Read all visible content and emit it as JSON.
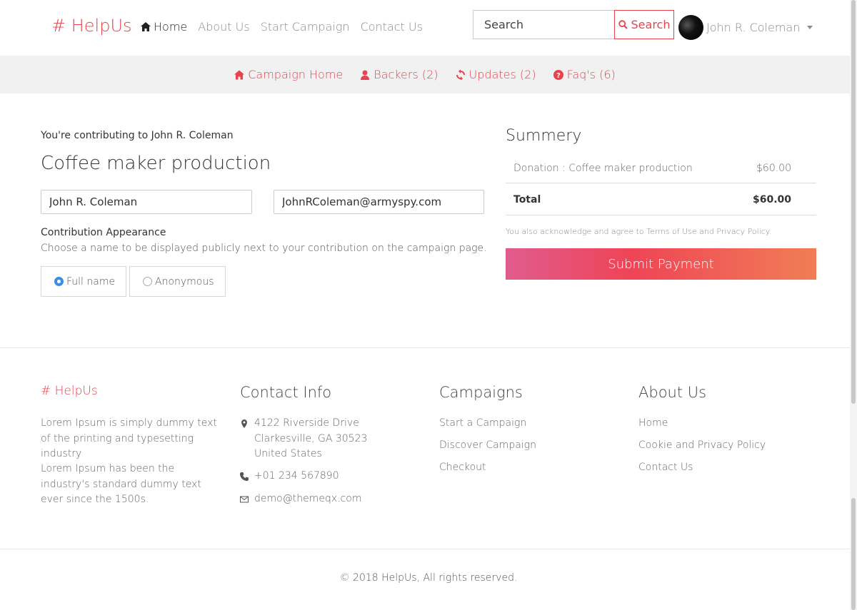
{
  "header": {
    "brand": "# HelpUs",
    "nav": [
      {
        "label": "Home",
        "active": true
      },
      {
        "label": "About Us"
      },
      {
        "label": "Start Campaign"
      },
      {
        "label": "Contact Us"
      }
    ],
    "search_placeholder": "Search",
    "search_button": "Search",
    "user_name": "John R. Coleman"
  },
  "subnav": {
    "campaign_home": "Campaign Home",
    "backers": "Backers (2)",
    "updates": "Updates (2)",
    "faqs": "Faq's (6)"
  },
  "form": {
    "contributing_to": "You're contributing to John R. Coleman",
    "campaign_title": "Coffee maker production",
    "name_value": "John R. Coleman",
    "email_value": "JohnRColeman@armyspy.com",
    "appearance_title": "Contribution Appearance",
    "appearance_desc": "Choose a name to be displayed publicly next to your contribution on the campaign page.",
    "option_full": "Full name",
    "option_anon": "Anonymous",
    "selected": "Full name"
  },
  "summary": {
    "title": "Summery",
    "item_label": "Donation : Coffee maker production",
    "item_amount": "$60.00",
    "total_label": "Total",
    "total_amount": "$60.00",
    "ack": "You also acknowledge and agree to Terms of Use and Privacy Policy.",
    "submit": "Submit Payment"
  },
  "footer": {
    "brand": "# HelpUs",
    "text1": "Lorem Ipsum is simply dummy text of the printing and typesetting industry",
    "text2": "Lorem Ipsum has been the industry's standard dummy text ever since the 1500s.",
    "contact_title": "Contact Info",
    "address_line1": "4122 Riverside Drive",
    "address_line2": "Clarkesville, GA 30523",
    "address_line3": "United States",
    "phone": "+01 234 567890",
    "email": "demo@themeqx.com",
    "campaigns_title": "Campaigns",
    "campaign_links": [
      "Start a Campaign",
      "Discover Campaign",
      "Checkout"
    ],
    "about_title": "About Us",
    "about_links": [
      "Home",
      "Cookie and Privacy Policy",
      "Contact Us"
    ],
    "copyright": "© 2018 HelpUs, All rights reserved."
  },
  "colors": {
    "brand": "#e8424f",
    "radio_checked": "#3b8ee6"
  }
}
